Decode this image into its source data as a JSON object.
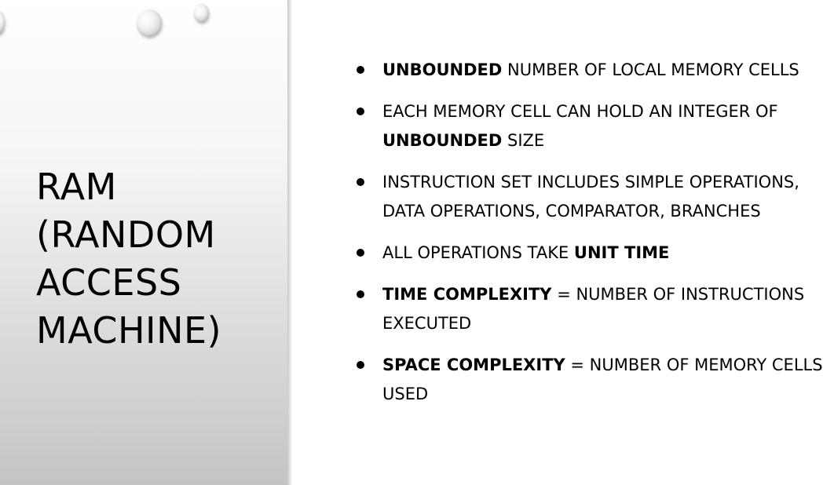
{
  "slide": {
    "title": "RAM\n(RANDOM\nACCESS\nMACHINE)",
    "bullets": [
      {
        "bold": "UNBOUNDED",
        "text": " NUMBER OF LOCAL MEMORY CELLS"
      },
      {
        "prefix": "EACH MEMORY CELL CAN HOLD AN INTEGER OF ",
        "bold": "UNBOUNDED",
        "text": " SIZE"
      },
      {
        "text": "INSTRUCTION SET INCLUDES SIMPLE OPERATIONS, DATA OPERATIONS, COMPARATOR, BRANCHES"
      },
      {
        "prefix": "ALL OPERATIONS TAKE ",
        "bold": "UNIT TIME"
      },
      {
        "bold": "TIME COMPLEXITY",
        "text": " = NUMBER OF INSTRUCTIONS EXECUTED"
      },
      {
        "bold": "SPACE COMPLEXITY",
        "text": " = NUMBER OF MEMORY CELLS USED"
      }
    ]
  },
  "colors": {
    "text": "#000000",
    "background": "#ffffff",
    "panel_top": "#ffffff",
    "panel_bottom": "#c4c4c4"
  }
}
